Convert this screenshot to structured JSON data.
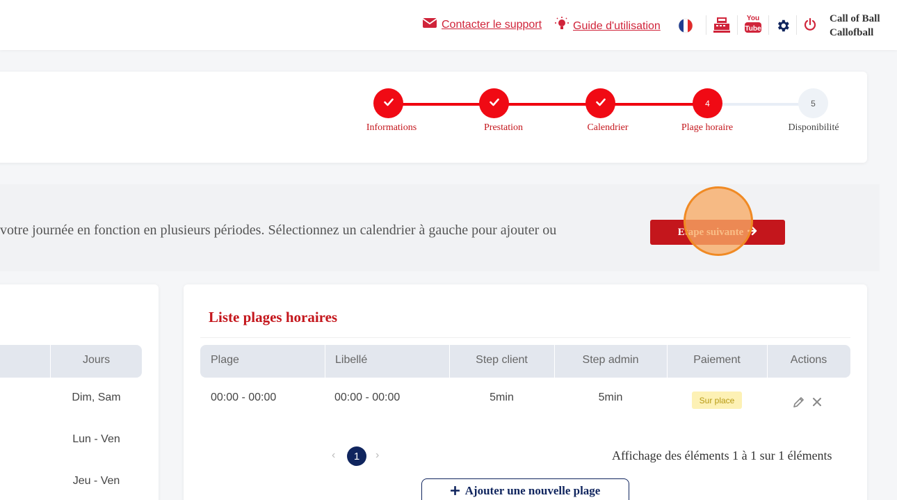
{
  "header": {
    "support_label": "Contacter le support",
    "guide_label": "Guide d'utilisation",
    "user_line1": "Call of Ball",
    "user_line2": "Callofball",
    "icons": [
      "envelope-icon",
      "lightbulb-icon",
      "france-flag-icon",
      "cash-register-icon",
      "youtube-icon",
      "gear-icon",
      "power-icon"
    ]
  },
  "stepper": {
    "steps": [
      {
        "number": "",
        "label": "Informations",
        "state": "done"
      },
      {
        "number": "",
        "label": "Prestation",
        "state": "done"
      },
      {
        "number": "",
        "label": "Calendrier",
        "state": "done"
      },
      {
        "number": "4",
        "label": "Plage horaire",
        "state": "active"
      },
      {
        "number": "5",
        "label": "Disponibilité",
        "state": "pending"
      }
    ]
  },
  "banner": {
    "text": "votre journée en fonction en plusieurs périodes. Sélectionnez un calendrier à gauche pour ajouter ou",
    "next_label": "Etape suivante"
  },
  "calendar_list": {
    "column": "Jours",
    "rows": [
      "Dim, Sam",
      "Lun - Ven",
      "Jeu - Ven"
    ]
  },
  "slots": {
    "title": "Liste plages horaires",
    "columns": [
      "Plage",
      "Libellé",
      "Step client",
      "Step admin",
      "Paiement",
      "Actions"
    ],
    "rows": [
      {
        "plage": "00:00 - 00:00",
        "libelle": "00:00 - 00:00",
        "step_client": "5min",
        "step_admin": "5min",
        "paiement": "Sur place"
      }
    ],
    "pagination": {
      "prev": "‹",
      "page": "1",
      "next": "›"
    },
    "info": "Affichage des éléments 1 à 1 sur 1 éléments",
    "add_label": "Ajouter une nouvelle plage"
  },
  "colors": {
    "brand_red": "#c4161c",
    "navy": "#10255e",
    "step_red": "#ff0000"
  }
}
